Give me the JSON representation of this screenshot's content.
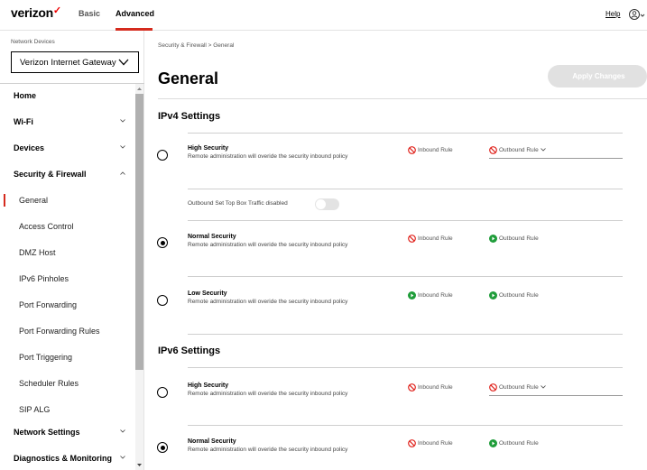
{
  "header": {
    "logo": "verizon",
    "tabs": [
      {
        "label": "Basic"
      },
      {
        "label": "Advanced"
      }
    ],
    "help": "Help",
    "accent_color": "#d52b1e"
  },
  "sidebar": {
    "device_label": "Network Devices",
    "device_selected": "Verizon Internet Gateway",
    "items": [
      {
        "label": "Home",
        "level": "top"
      },
      {
        "label": "Wi-Fi",
        "level": "top",
        "chevron": "down"
      },
      {
        "label": "Devices",
        "level": "top",
        "chevron": "down"
      },
      {
        "label": "Security & Firewall",
        "level": "top",
        "chevron": "up"
      },
      {
        "label": "General",
        "level": "sub",
        "selected": true
      },
      {
        "label": "Access Control",
        "level": "sub"
      },
      {
        "label": "DMZ Host",
        "level": "sub"
      },
      {
        "label": "IPv6 Pinholes",
        "level": "sub"
      },
      {
        "label": "Port Forwarding",
        "level": "sub"
      },
      {
        "label": "Port Forwarding Rules",
        "level": "sub"
      },
      {
        "label": "Port Triggering",
        "level": "sub"
      },
      {
        "label": "Scheduler Rules",
        "level": "sub"
      },
      {
        "label": "SIP ALG",
        "level": "sub"
      },
      {
        "label": "Network Settings",
        "level": "top",
        "chevron": "down"
      },
      {
        "label": "Diagnostics & Monitoring",
        "level": "top",
        "chevron": "down"
      }
    ]
  },
  "main": {
    "breadcrumb": [
      "Security & Firewall",
      "General"
    ],
    "breadcrumb_separator": ">",
    "title": "General",
    "apply_button": "Apply Changes",
    "ipv4": {
      "heading": "IPv4 Settings",
      "high": {
        "title": "High Security",
        "desc": "Remote administration will overide the security inbound policy",
        "inbound": "Inbound Rule",
        "outbound": "Outbound Rule",
        "selected": false
      },
      "toggle_label": "Outbound Set Top Box Traffic disabled",
      "toggle_on": false,
      "normal": {
        "title": "Normal Security",
        "desc": "Remote administration will overide the security inbound policy",
        "inbound": "Inbound Rule",
        "outbound": "Outbound Rule",
        "selected": true
      },
      "low": {
        "title": "Low Security",
        "desc": "Remote administration will overide the security inbound policy",
        "inbound": "Inbound Rule",
        "outbound": "Outbound Rule",
        "selected": false
      }
    },
    "ipv6": {
      "heading": "IPv6 Settings",
      "high": {
        "title": "High Security",
        "desc": "Remote administration will overide the security inbound policy",
        "inbound": "Inbound Rule",
        "outbound": "Outbound Rule",
        "selected": false
      },
      "normal": {
        "title": "Normal Security",
        "desc": "Remote administration will overide the security inbound policy",
        "inbound": "Inbound Rule",
        "outbound": "Outbound Rule",
        "selected": true
      }
    },
    "status_colors": {
      "blocked": "#e0201a",
      "allowed": "#1f9d3a"
    }
  }
}
